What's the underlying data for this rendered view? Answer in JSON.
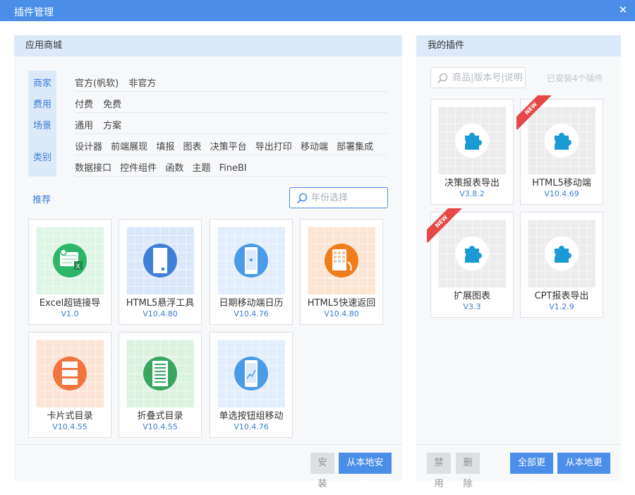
{
  "window": {
    "title": "插件管理"
  },
  "store": {
    "header": "应用商城",
    "filters": {
      "vendor": {
        "label": "商家",
        "options": [
          "官方(帆软)",
          "非官方"
        ]
      },
      "fee": {
        "label": "费用",
        "options": [
          "付费",
          "免费"
        ]
      },
      "scene": {
        "label": "场景",
        "options": [
          "通用",
          "方案"
        ]
      },
      "category": {
        "label": "类别",
        "options_row1": [
          "设计器",
          "前端展现",
          "填报",
          "图表",
          "决策平台",
          "导出打印",
          "移动端",
          "部署集成"
        ],
        "options_row2": [
          "数据接口",
          "控件组件",
          "函数",
          "主题",
          "FineBI"
        ]
      }
    },
    "recommend_label": "推荐",
    "year_search": {
      "placeholder": "年份选择",
      "value": ""
    },
    "plugins": [
      {
        "name": "Excel超链接导",
        "version": "V1.0",
        "bg": "#dff5e6",
        "circle": "#2db56a",
        "icon": "excel-icon"
      },
      {
        "name": "HTML5悬浮工具",
        "version": "V10.4.80",
        "bg": "#dbe8f9",
        "circle": "#3f7fd6",
        "icon": "document-icon"
      },
      {
        "name": "日期移动端日历",
        "version": "V10.4.76",
        "bg": "#e2eefb",
        "circle": "#4a9be8",
        "icon": "phone-icon"
      },
      {
        "name": "HTML5快速返回",
        "version": "V10.4.80",
        "bg": "#fde5d3",
        "circle": "#f07d1c",
        "icon": "grid-icon"
      },
      {
        "name": "卡片式目录",
        "version": "V10.4.55",
        "bg": "#fde4d6",
        "circle": "#f2753d",
        "icon": "card-list-icon"
      },
      {
        "name": "折叠式目录",
        "version": "V10.4.55",
        "bg": "#dcf3e2",
        "circle": "#3aa55f",
        "icon": "fold-list-icon"
      },
      {
        "name": "单选按钮组移动",
        "version": "V10.4.76",
        "bg": "#e2eefb",
        "circle": "#4a9be8",
        "icon": "phone-chart-icon"
      }
    ],
    "buttons": {
      "install": "安装",
      "install_local": "从本地安装"
    }
  },
  "mine": {
    "header": "我的插件",
    "search": {
      "placeholder": "商品|版本号|说明",
      "value": ""
    },
    "installed_count": "已安装4个插件",
    "plugins": [
      {
        "name": "决策报表导出",
        "version": "V3.8.2",
        "is_new": false
      },
      {
        "name": "HTML5移动端",
        "version": "V10.4.69",
        "is_new": true
      },
      {
        "name": "扩展图表",
        "version": "V3.3",
        "is_new": true
      },
      {
        "name": "CPT报表导出",
        "version": "V1.2.9",
        "is_new": false
      }
    ],
    "new_badge": "NEW",
    "buttons": {
      "disable": "禁用",
      "delete": "删除",
      "update_all": "全部更新",
      "update_local": "从本地更新"
    }
  },
  "colors": {
    "accent": "#4b8ee8",
    "header_bg": "#dbe9f8",
    "puzzle": "#1c9ad6",
    "ribbon": "#e64848"
  }
}
